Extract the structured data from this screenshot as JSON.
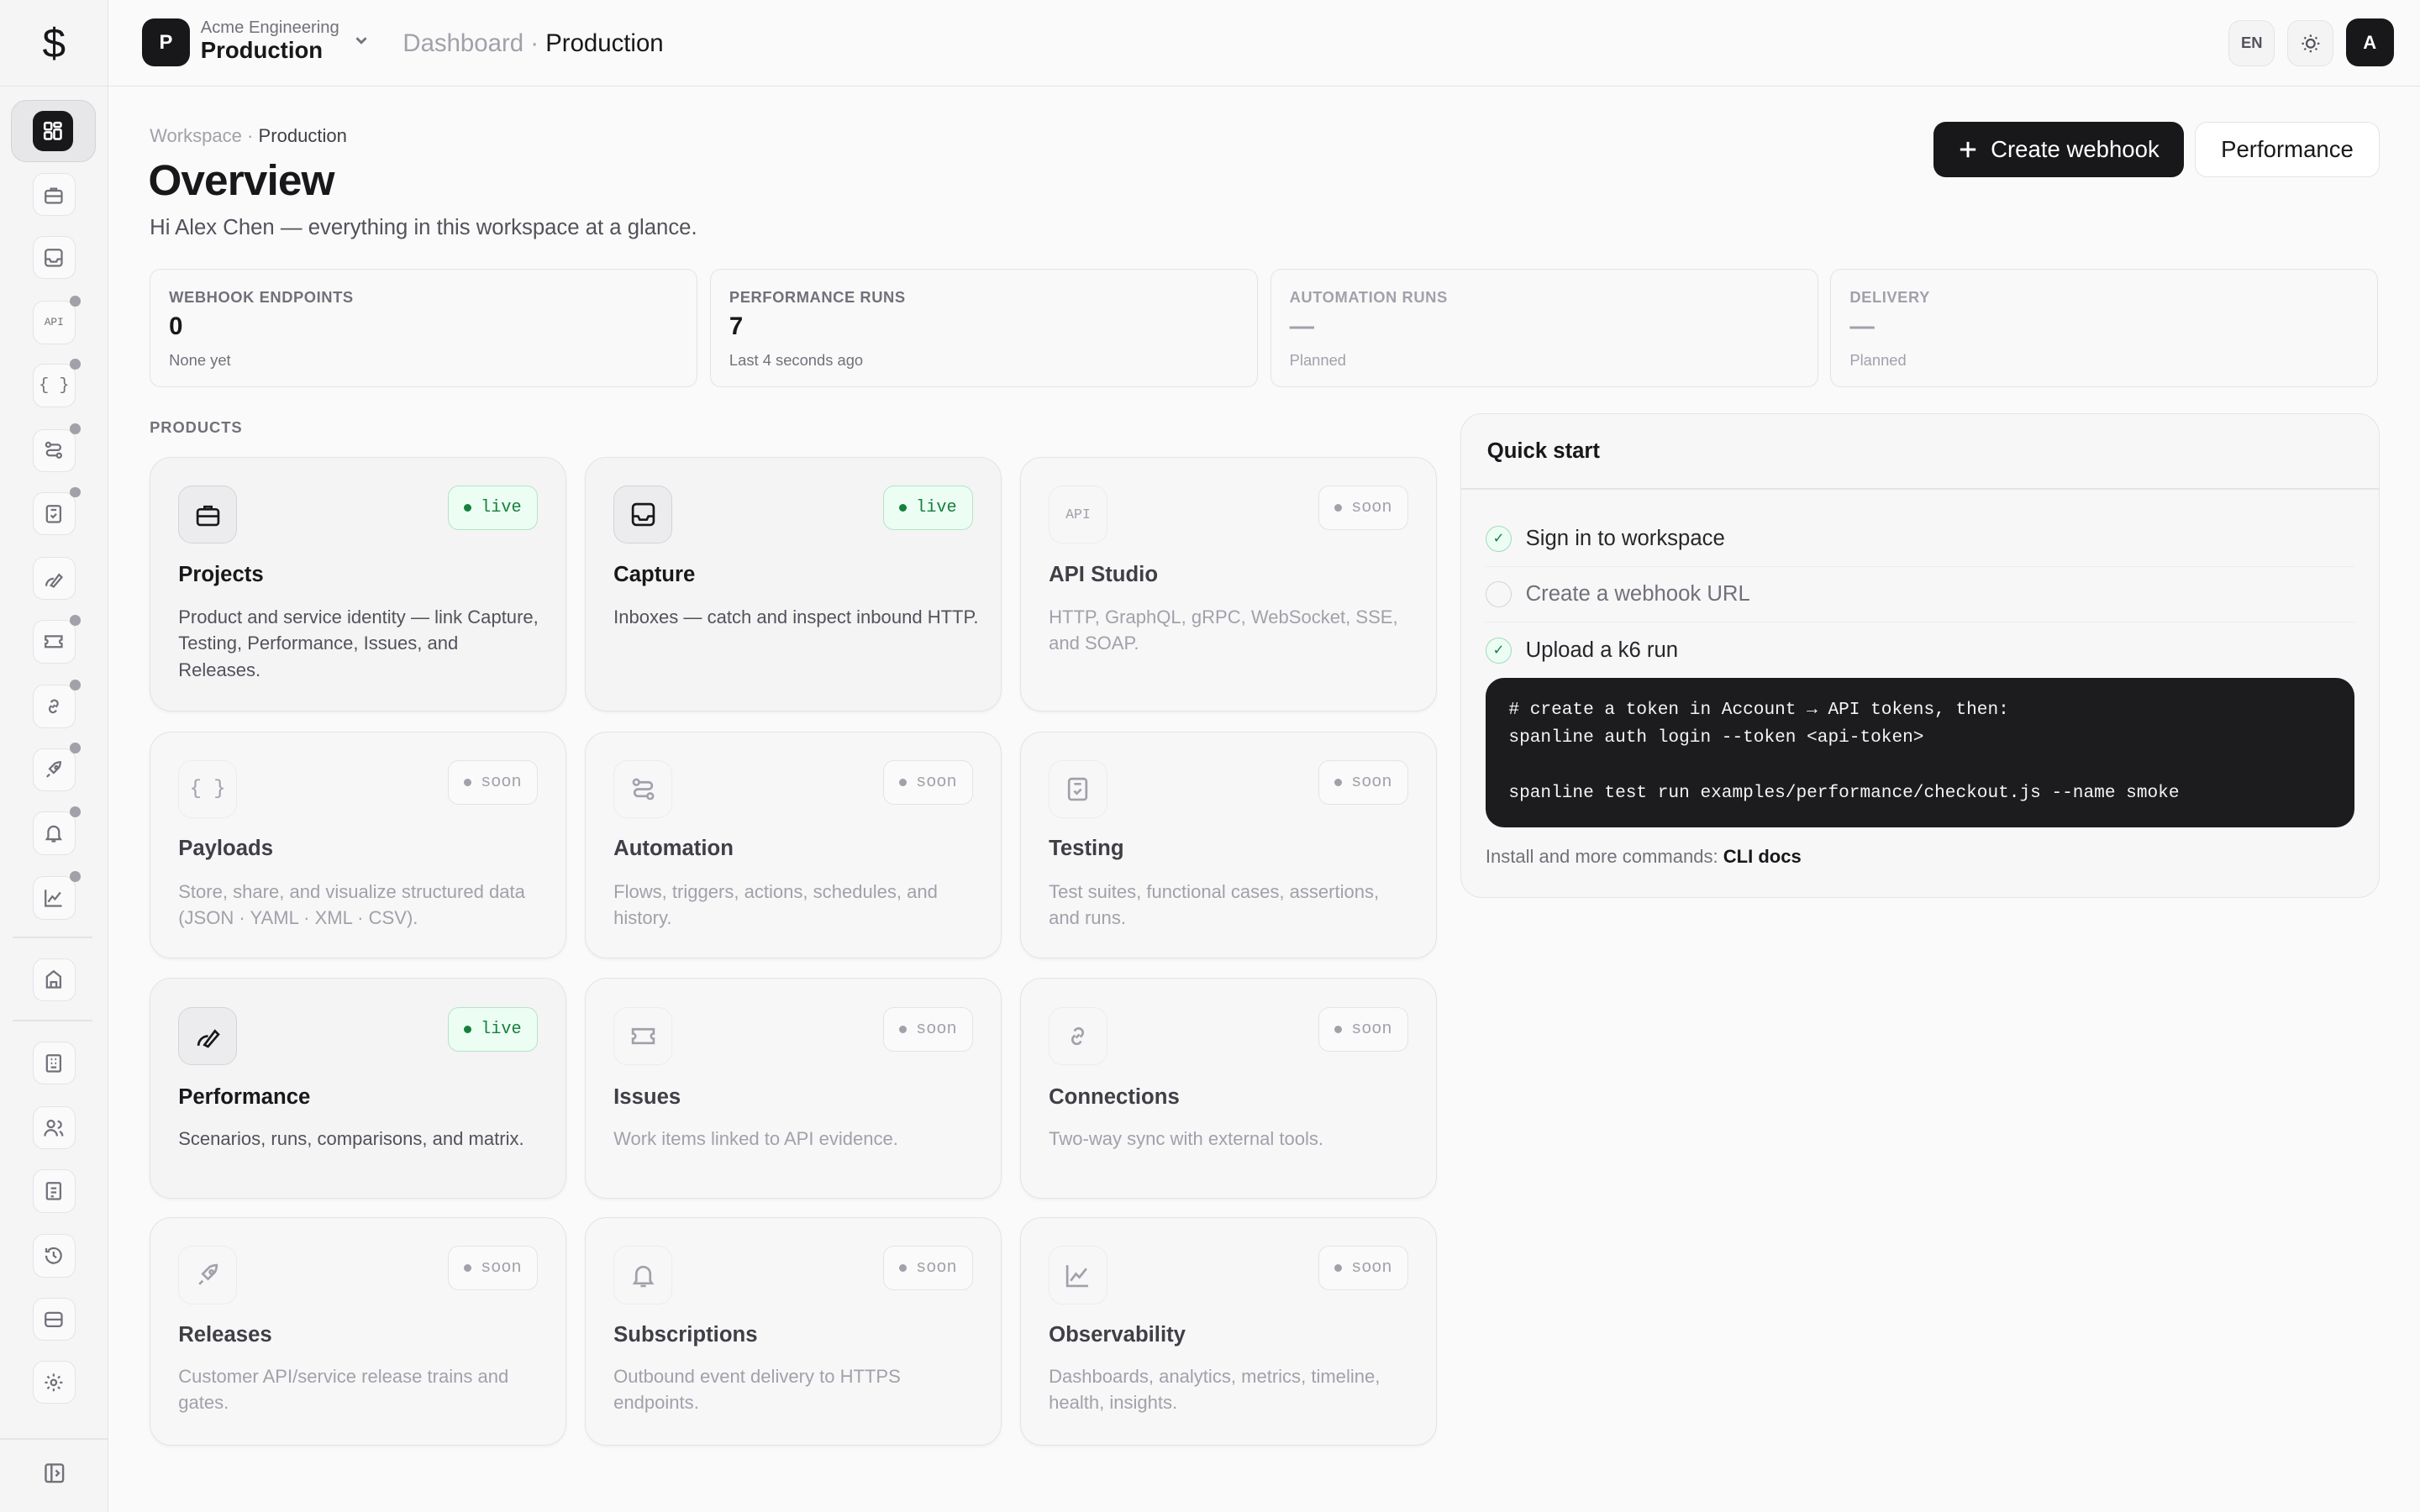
{
  "app": {
    "logo_glyph": "$"
  },
  "header": {
    "workspace_badge": "P",
    "org": "Acme Engineering",
    "workspace": "Production",
    "crumb_root": "Dashboard",
    "crumb_sep": " · ",
    "crumb_current": "Production",
    "lang": "EN",
    "avatar": "A"
  },
  "page": {
    "breadcrumb_root": "Workspace",
    "breadcrumb_sep": " · ",
    "breadcrumb_current": "Production",
    "title": "Overview",
    "subtitle": "Hi Alex Chen — everything in this workspace at a glance.",
    "create_button": "Create webhook",
    "performance_button": "Performance"
  },
  "stats": [
    {
      "label": "WEBHOOK ENDPOINTS",
      "value": "0",
      "note": "None yet"
    },
    {
      "label": "PERFORMANCE RUNS",
      "value": "7",
      "note": "Last 4 seconds ago"
    },
    {
      "label": "AUTOMATION RUNS",
      "value": "—",
      "note": "Planned"
    },
    {
      "label": "DELIVERY",
      "value": "—",
      "note": "Planned"
    }
  ],
  "products_label": "PRODUCTS",
  "products": [
    {
      "name": "Projects",
      "badge": "live",
      "desc": "Product and service identity — link Capture, Testing, Performance, Issues, and Releases.",
      "icon": "briefcase-icon"
    },
    {
      "name": "Capture",
      "badge": "live",
      "desc": "Inboxes — catch and inspect inbound HTTP.",
      "icon": "inbox-icon"
    },
    {
      "name": "API Studio",
      "badge": "soon",
      "desc": "HTTP, GraphQL, gRPC, WebSocket, SSE, and SOAP.",
      "icon": "api-icon"
    },
    {
      "name": "Payloads",
      "badge": "soon",
      "desc": "Store, share, and visualize structured data (JSON · YAML · XML · CSV).",
      "icon": "braces-icon"
    },
    {
      "name": "Automation",
      "badge": "soon",
      "desc": "Flows, triggers, actions, schedules, and history.",
      "icon": "workflow-icon"
    },
    {
      "name": "Testing",
      "badge": "soon",
      "desc": "Test suites, functional cases, assertions, and runs.",
      "icon": "clipboard-check-icon"
    },
    {
      "name": "Performance",
      "badge": "live",
      "desc": "Scenarios, runs, comparisons, and matrix.",
      "icon": "gauge-icon"
    },
    {
      "name": "Issues",
      "badge": "soon",
      "desc": "Work items linked to API evidence.",
      "icon": "ticket-icon"
    },
    {
      "name": "Connections",
      "badge": "soon",
      "desc": "Two-way sync with external tools.",
      "icon": "link-icon"
    },
    {
      "name": "Releases",
      "badge": "soon",
      "desc": "Customer API/service release trains and gates.",
      "icon": "rocket-icon"
    },
    {
      "name": "Subscriptions",
      "badge": "soon",
      "desc": "Outbound event delivery to HTTPS endpoints.",
      "icon": "bell-icon"
    },
    {
      "name": "Observability",
      "badge": "soon",
      "desc": "Dashboards, analytics, metrics, timeline, health, insights.",
      "icon": "chart-area-icon"
    }
  ],
  "quickstart": {
    "title": "Quick start",
    "steps": [
      {
        "label": "Sign in to workspace",
        "done": true,
        "mark": "✓"
      },
      {
        "label": "Create a webhook URL",
        "done": false,
        "mark": ""
      },
      {
        "label": "Upload a k6 run",
        "done": true,
        "mark": "✓"
      }
    ],
    "code_line1": "# create a token in Account → API tokens, then:",
    "code_line2": "spanline auth login --token <api-token>",
    "code_line3": "spanline test run examples/performance/checkout.js --name smoke",
    "footer_text": "Install and more commands: ",
    "footer_link": "CLI docs"
  },
  "sidebar_icons": [
    "dashboard-icon",
    "briefcase-icon",
    "inbox-icon",
    "api-icon",
    "braces-icon",
    "workflow-icon",
    "clipboard-check-icon",
    "gauge-icon",
    "ticket-icon",
    "link-icon",
    "rocket-icon",
    "bell-icon",
    "chart-area-icon",
    "building-icon",
    "organization-icon",
    "users-icon",
    "report-icon",
    "history-icon",
    "storage-icon",
    "gear-icon",
    "panel-toggle-icon"
  ]
}
